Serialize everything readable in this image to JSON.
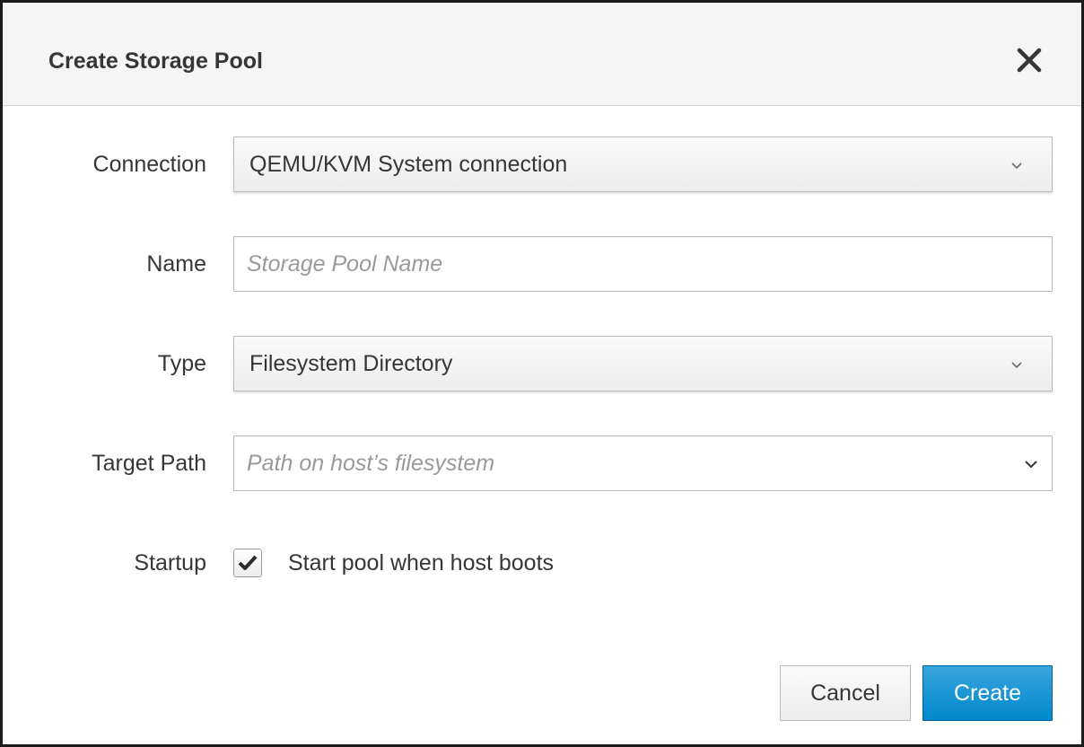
{
  "dialog": {
    "title": "Create Storage Pool",
    "close_icon": "close-icon"
  },
  "form": {
    "connection": {
      "label": "Connection",
      "value": "QEMU/KVM System connection"
    },
    "name": {
      "label": "Name",
      "placeholder": "Storage Pool Name"
    },
    "type": {
      "label": "Type",
      "value": "Filesystem Directory"
    },
    "target_path": {
      "label": "Target Path",
      "placeholder": "Path on host’s filesystem"
    },
    "startup": {
      "label": "Startup",
      "checkbox_label": "Start pool when host boots",
      "checked": true
    }
  },
  "footer": {
    "cancel_label": "Cancel",
    "create_label": "Create"
  },
  "colors": {
    "primary": "#0088ce",
    "header_bg": "#f5f5f5",
    "text": "#363636",
    "placeholder": "#9a9a9a"
  }
}
